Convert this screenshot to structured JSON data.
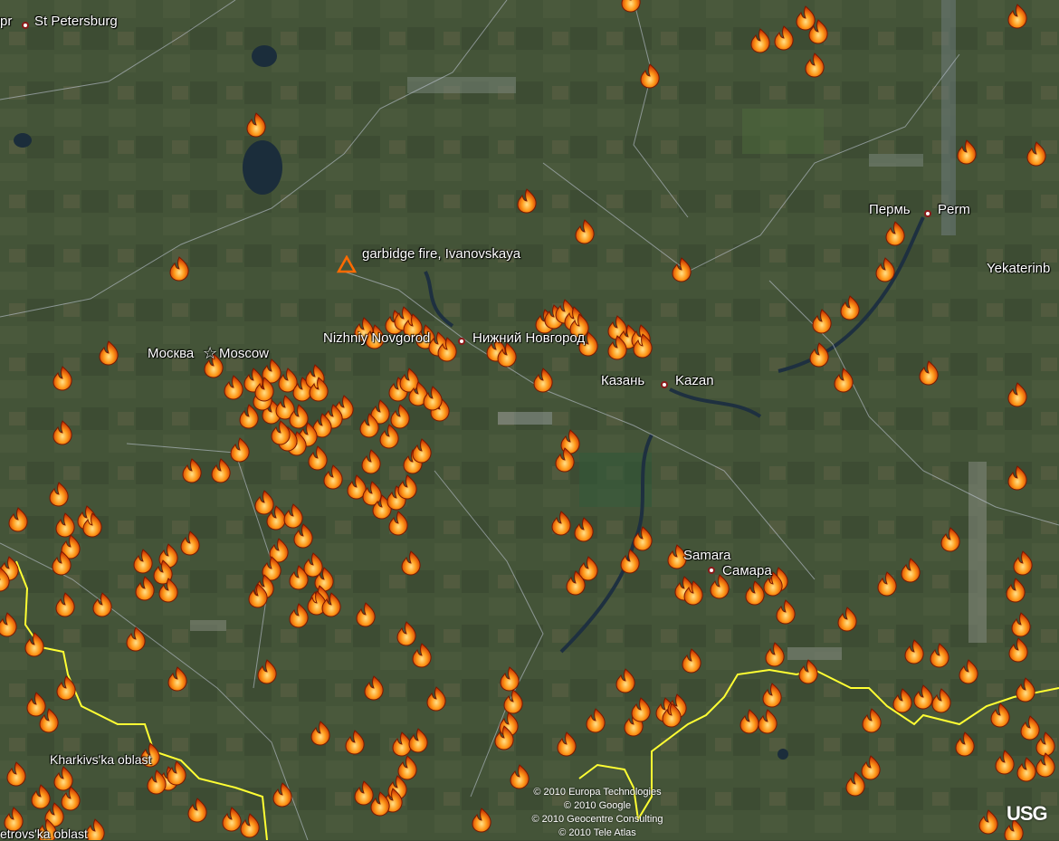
{
  "map": {
    "places": [
      {
        "id": "st-petersburg",
        "label": "St Petersburg",
        "prefix": "pr"
      },
      {
        "id": "moscow",
        "label": "Москва",
        "label2": "Moscow",
        "marker": "star"
      },
      {
        "id": "nizhniy",
        "label": "Nizhniy Novgorod",
        "label2": "Нижний Новгород"
      },
      {
        "id": "kazan",
        "label": "Казань",
        "label2": "Kazan"
      },
      {
        "id": "perm",
        "label": "Пермь",
        "label2": "Perm"
      },
      {
        "id": "yekaterinburg",
        "label": "Yekaterinb"
      },
      {
        "id": "samara",
        "label": "Samara",
        "label2": "Самара"
      },
      {
        "id": "kharkiv",
        "label": "Kharkivs'ka oblast"
      },
      {
        "id": "petrovs",
        "label": "etrovs'ka oblast"
      }
    ],
    "annotation": {
      "label": "garbidge fire, Ivanovskaya",
      "icon": "triangle-warning-icon"
    },
    "fire_icon": "fire-icon",
    "copyright": [
      "© 2010 Europa Technologies",
      "© 2010 Google",
      "© 2010 Geocentre Consulting",
      "© 2010 Tele Atlas"
    ],
    "logo": "USG",
    "colors": {
      "fire": "#ff8c00",
      "border": "#ffff33",
      "water": "#1b2d3b",
      "ground": "#3d4a34"
    }
  }
}
